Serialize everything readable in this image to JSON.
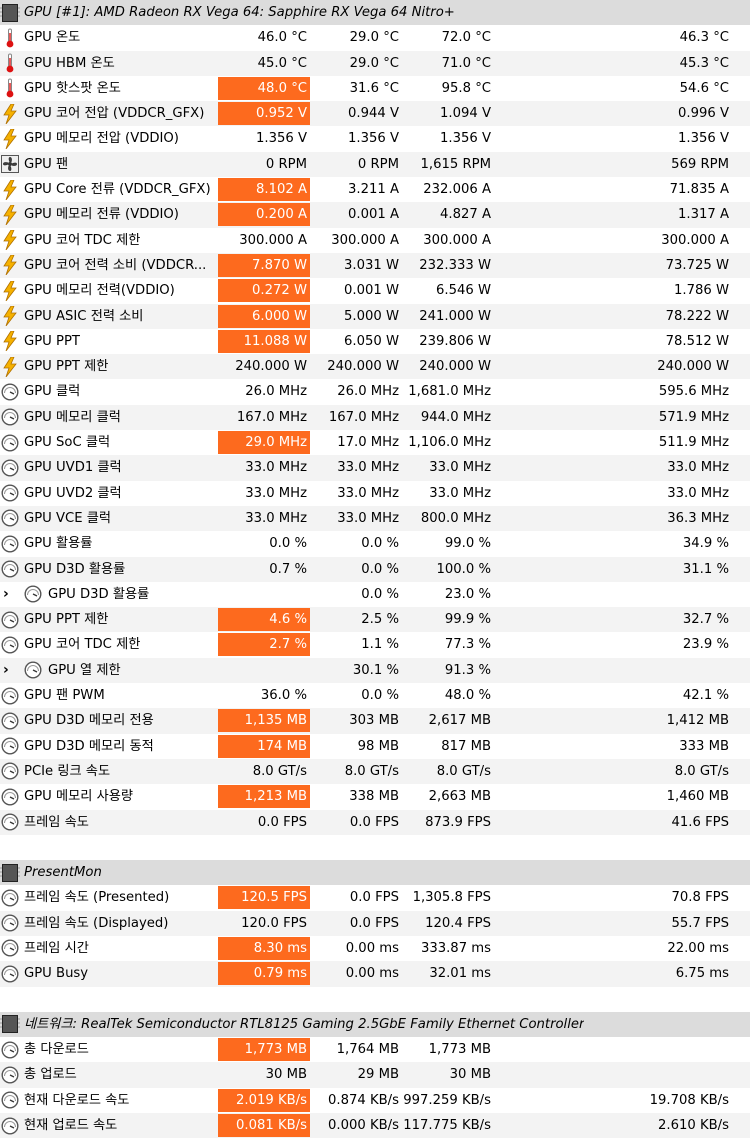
{
  "colors": {
    "highlight": "#fd6a1e",
    "header_bg": "#dcdcdc",
    "alt_row": "#f3f3f3"
  },
  "rows": [
    {
      "type": "header",
      "icon": "chip-icon",
      "label": "GPU [#1]: AMD Radeon RX Vega 64: Sapphire RX Vega 64 Nitro+"
    },
    {
      "type": "data",
      "icon": "thermometer-icon",
      "label": "GPU 온도",
      "v": [
        "46.0 °C",
        "29.0 °C",
        "72.0 °C",
        "46.3 °C"
      ],
      "hl": false
    },
    {
      "type": "data",
      "icon": "thermometer-icon",
      "label": "GPU HBM 온도",
      "v": [
        "45.0 °C",
        "29.0 °C",
        "71.0 °C",
        "45.3 °C"
      ],
      "hl": false
    },
    {
      "type": "data",
      "icon": "thermometer-icon",
      "label": "GPU 핫스팟 온도",
      "v": [
        "48.0 °C",
        "31.6 °C",
        "95.8 °C",
        "54.6 °C"
      ],
      "hl": true
    },
    {
      "type": "data",
      "icon": "lightning-icon",
      "label": "GPU 코어 전압 (VDDCR_GFX)",
      "v": [
        "0.952 V",
        "0.944 V",
        "1.094 V",
        "0.996 V"
      ],
      "hl": true
    },
    {
      "type": "data",
      "icon": "lightning-icon",
      "label": "GPU 메모리 전압 (VDDIO)",
      "v": [
        "1.356 V",
        "1.356 V",
        "1.356 V",
        "1.356 V"
      ],
      "hl": false
    },
    {
      "type": "data",
      "icon": "fan-icon",
      "label": "GPU 팬",
      "v": [
        "0 RPM",
        "0 RPM",
        "1,615 RPM",
        "569 RPM"
      ],
      "hl": false
    },
    {
      "type": "data",
      "icon": "lightning-icon",
      "label": "GPU Core 전류 (VDDCR_GFX)",
      "v": [
        "8.102 A",
        "3.211 A",
        "232.006 A",
        "71.835 A"
      ],
      "hl": true
    },
    {
      "type": "data",
      "icon": "lightning-icon",
      "label": "GPU 메모리 전류 (VDDIO)",
      "v": [
        "0.200 A",
        "0.001 A",
        "4.827 A",
        "1.317 A"
      ],
      "hl": true
    },
    {
      "type": "data",
      "icon": "lightning-icon",
      "label": "GPU 코어 TDC 제한",
      "v": [
        "300.000 A",
        "300.000 A",
        "300.000 A",
        "300.000 A"
      ],
      "hl": false
    },
    {
      "type": "data",
      "icon": "lightning-icon",
      "label": "GPU 코어 전력 소비 (VDDCR...",
      "v": [
        "7.870 W",
        "3.031 W",
        "232.333 W",
        "73.725 W"
      ],
      "hl": true
    },
    {
      "type": "data",
      "icon": "lightning-icon",
      "label": "GPU 메모리 전력(VDDIO)",
      "v": [
        "0.272 W",
        "0.001 W",
        "6.546 W",
        "1.786 W"
      ],
      "hl": true
    },
    {
      "type": "data",
      "icon": "lightning-icon",
      "label": "GPU ASIC 전력 소비",
      "v": [
        "6.000 W",
        "5.000 W",
        "241.000 W",
        "78.222 W"
      ],
      "hl": true
    },
    {
      "type": "data",
      "icon": "lightning-icon",
      "label": "GPU PPT",
      "v": [
        "11.088 W",
        "6.050 W",
        "239.806 W",
        "78.512 W"
      ],
      "hl": true
    },
    {
      "type": "data",
      "icon": "lightning-icon",
      "label": "GPU PPT 제한",
      "v": [
        "240.000 W",
        "240.000 W",
        "240.000 W",
        "240.000 W"
      ],
      "hl": false
    },
    {
      "type": "data",
      "icon": "clock-icon",
      "label": "GPU 클럭",
      "v": [
        "26.0 MHz",
        "26.0 MHz",
        "1,681.0 MHz",
        "595.6 MHz"
      ],
      "hl": false
    },
    {
      "type": "data",
      "icon": "clock-icon",
      "label": "GPU 메모리 클럭",
      "v": [
        "167.0 MHz",
        "167.0 MHz",
        "944.0 MHz",
        "571.9 MHz"
      ],
      "hl": false
    },
    {
      "type": "data",
      "icon": "clock-icon",
      "label": "GPU SoC 클럭",
      "v": [
        "29.0 MHz",
        "17.0 MHz",
        "1,106.0 MHz",
        "511.9 MHz"
      ],
      "hl": true
    },
    {
      "type": "data",
      "icon": "clock-icon",
      "label": "GPU UVD1 클럭",
      "v": [
        "33.0 MHz",
        "33.0 MHz",
        "33.0 MHz",
        "33.0 MHz"
      ],
      "hl": false
    },
    {
      "type": "data",
      "icon": "clock-icon",
      "label": "GPU UVD2 클럭",
      "v": [
        "33.0 MHz",
        "33.0 MHz",
        "33.0 MHz",
        "33.0 MHz"
      ],
      "hl": false
    },
    {
      "type": "data",
      "icon": "clock-icon",
      "label": "GPU VCE 클럭",
      "v": [
        "33.0 MHz",
        "33.0 MHz",
        "800.0 MHz",
        "36.3 MHz"
      ],
      "hl": false
    },
    {
      "type": "data",
      "icon": "clock-icon",
      "label": "GPU 활용률",
      "v": [
        "0.0 %",
        "0.0 %",
        "99.0 %",
        "34.9 %"
      ],
      "hl": false
    },
    {
      "type": "data",
      "icon": "clock-icon",
      "label": "GPU D3D 활용률",
      "v": [
        "0.7 %",
        "0.0 %",
        "100.0 %",
        "31.1 %"
      ],
      "hl": false
    },
    {
      "type": "child",
      "icon": "clock-icon",
      "label": "GPU D3D 활용률",
      "v": [
        "",
        "0.0 %",
        "23.0 %",
        ""
      ],
      "hl": false
    },
    {
      "type": "data",
      "icon": "clock-icon",
      "label": "GPU PPT 제한",
      "v": [
        "4.6 %",
        "2.5 %",
        "99.9 %",
        "32.7 %"
      ],
      "hl": true
    },
    {
      "type": "data",
      "icon": "clock-icon",
      "label": "GPU 코어 TDC 제한",
      "v": [
        "2.7 %",
        "1.1 %",
        "77.3 %",
        "23.9 %"
      ],
      "hl": true
    },
    {
      "type": "child",
      "icon": "clock-icon",
      "label": "GPU 열 제한",
      "v": [
        "",
        "30.1 %",
        "91.3 %",
        ""
      ],
      "hl": false
    },
    {
      "type": "data",
      "icon": "clock-icon",
      "label": "GPU 팬 PWM",
      "v": [
        "36.0 %",
        "0.0 %",
        "48.0 %",
        "42.1 %"
      ],
      "hl": false
    },
    {
      "type": "data",
      "icon": "clock-icon",
      "label": "GPU D3D 메모리 전용",
      "v": [
        "1,135 MB",
        "303 MB",
        "2,617 MB",
        "1,412 MB"
      ],
      "hl": true
    },
    {
      "type": "data",
      "icon": "clock-icon",
      "label": "GPU D3D 메모리 동적",
      "v": [
        "174 MB",
        "98 MB",
        "817 MB",
        "333 MB"
      ],
      "hl": true
    },
    {
      "type": "data",
      "icon": "clock-icon",
      "label": "PCIe 링크 속도",
      "v": [
        "8.0 GT/s",
        "8.0 GT/s",
        "8.0 GT/s",
        "8.0 GT/s"
      ],
      "hl": false
    },
    {
      "type": "data",
      "icon": "clock-icon",
      "label": "GPU 메모리 사용량",
      "v": [
        "1,213 MB",
        "338 MB",
        "2,663 MB",
        "1,460 MB"
      ],
      "hl": true
    },
    {
      "type": "data",
      "icon": "clock-icon",
      "label": "프레임 속도",
      "v": [
        "0.0 FPS",
        "0.0 FPS",
        "873.9 FPS",
        "41.6 FPS"
      ],
      "hl": false
    },
    {
      "type": "blank"
    },
    {
      "type": "header",
      "icon": "chip-icon",
      "label": "PresentMon"
    },
    {
      "type": "data",
      "icon": "clock-icon",
      "label": "프레임 속도 (Presented)",
      "v": [
        "120.5 FPS",
        "0.0 FPS",
        "1,305.8 FPS",
        "70.8 FPS"
      ],
      "hl": true
    },
    {
      "type": "data",
      "icon": "clock-icon",
      "label": "프레임 속도 (Displayed)",
      "v": [
        "120.0 FPS",
        "0.0 FPS",
        "120.4 FPS",
        "55.7 FPS"
      ],
      "hl": false
    },
    {
      "type": "data",
      "icon": "clock-icon",
      "label": "프레임 시간",
      "v": [
        "8.30 ms",
        "0.00 ms",
        "333.87 ms",
        "22.00 ms"
      ],
      "hl": true
    },
    {
      "type": "data",
      "icon": "clock-icon",
      "label": "GPU Busy",
      "v": [
        "0.79 ms",
        "0.00 ms",
        "32.01 ms",
        "6.75 ms"
      ],
      "hl": true
    },
    {
      "type": "blank"
    },
    {
      "type": "header",
      "icon": "chip-icon",
      "label": "네트워크: RealTek Semiconductor RTL8125 Gaming 2.5GbE Family Ethernet Controller"
    },
    {
      "type": "data",
      "icon": "clock-icon",
      "label": "총 다운로드",
      "v": [
        "1,773 MB",
        "1,764 MB",
        "1,773 MB",
        ""
      ],
      "hl": true
    },
    {
      "type": "data",
      "icon": "clock-icon",
      "label": "총 업로드",
      "v": [
        "30 MB",
        "29 MB",
        "30 MB",
        ""
      ],
      "hl": false
    },
    {
      "type": "data",
      "icon": "clock-icon",
      "label": "현재 다운로드 속도",
      "v": [
        "2.019 KB/s",
        "0.874 KB/s",
        "997.259 KB/s",
        "19.708 KB/s"
      ],
      "hl": true
    },
    {
      "type": "data",
      "icon": "clock-icon",
      "label": "현재 업로드 속도",
      "v": [
        "0.081 KB/s",
        "0.000 KB/s",
        "117.775 KB/s",
        "2.610 KB/s"
      ],
      "hl": true
    }
  ]
}
